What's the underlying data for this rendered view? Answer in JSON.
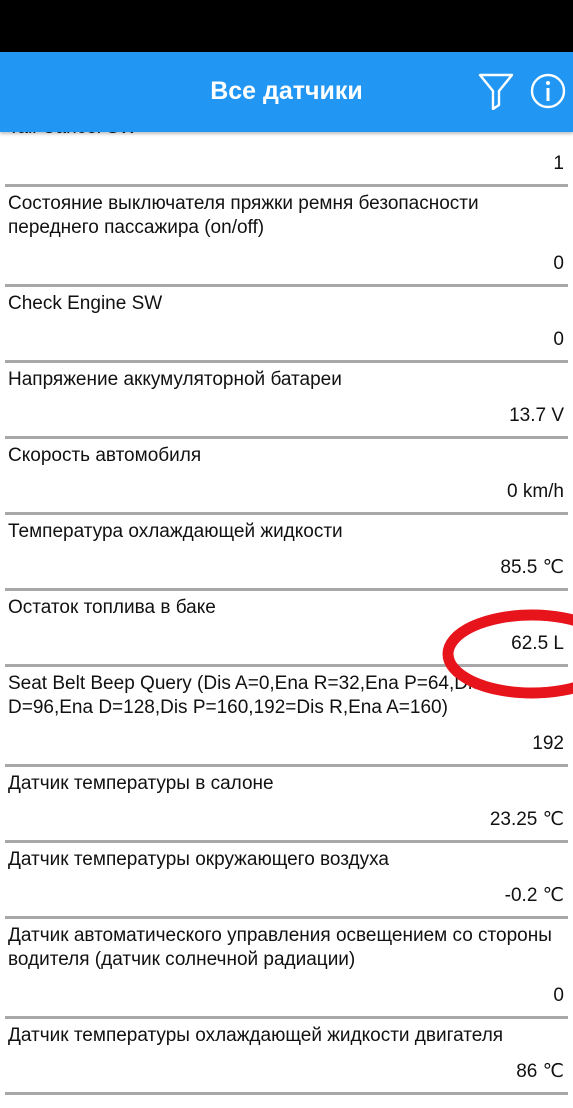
{
  "app_bar": {
    "title": "Все датчики",
    "filter_icon": "filter-funnel-icon",
    "info_icon": "info-icon",
    "color": "#2196f3"
  },
  "sensors": [
    {
      "name": "Tail Cancel SW",
      "value": "1"
    },
    {
      "name": "Состояние выключателя пряжки ремня безопасности переднего пассажира (on/off)",
      "value": "0"
    },
    {
      "name": "Check Engine SW",
      "value": "0"
    },
    {
      "name": "Напряжение аккумуляторной батареи",
      "value": "13.7 V"
    },
    {
      "name": "Скорость автомобиля",
      "value": "0 km/h"
    },
    {
      "name": "Температура охлаждающей жидкости",
      "value": "85.5 ℃"
    },
    {
      "name": "Остаток топлива в баке",
      "value": "62.5 L"
    },
    {
      "name": "Seat Belt Beep Query (Dis A=0,Ena R=32,Ena P=64,Dis D=96,Ena D=128,Dis P=160,192=Dis R,Ena A=160)",
      "value": "192"
    },
    {
      "name": "Датчик температуры в салоне",
      "value": "23.25 ℃"
    },
    {
      "name": "Датчик температуры окружающего воздуха",
      "value": "-0.2 ℃"
    },
    {
      "name": "Датчик автоматического управления освещением со стороны водителя (датчик солнечной радиации)",
      "value": "0"
    },
    {
      "name": "Датчик температуры охлаждающей жидкости двигателя",
      "value": "86 ℃"
    }
  ],
  "annotation": {
    "shape": "ellipse",
    "color": "#e8141c"
  }
}
